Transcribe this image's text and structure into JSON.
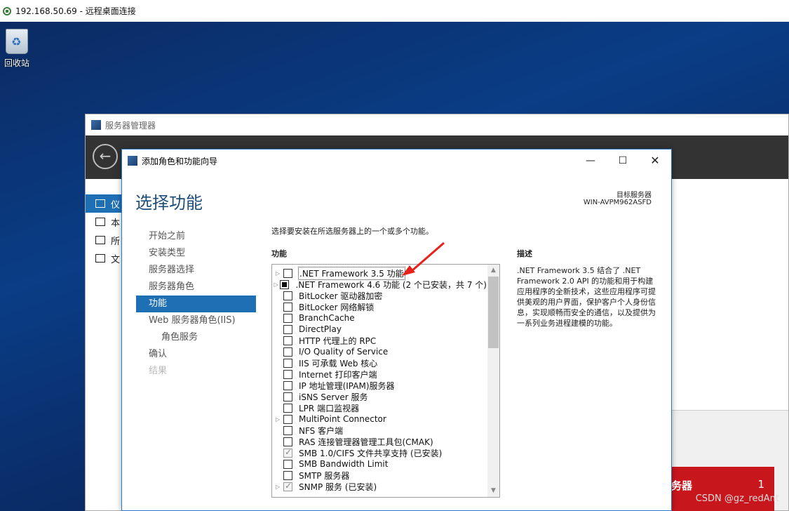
{
  "rdp": {
    "title": "192.168.50.69 - 远程桌面连接"
  },
  "desktop": {
    "recycle_bin_label": "回收站"
  },
  "server_manager": {
    "title": "服务器管理器",
    "back_icon": "back-arrow-icon",
    "nav_items": [
      "仪",
      "本",
      "所",
      "文"
    ],
    "tile_label": "务器",
    "tile_count": "1",
    "accent_color": "#1f6fb5",
    "tile_color": "#c8161d"
  },
  "wizard": {
    "title": "添加角色和功能向导",
    "heading": "选择功能",
    "target_label": "目标服务器",
    "target_value": "WIN-AVPM962ASFD",
    "steps": [
      {
        "label": "开始之前",
        "state": "normal"
      },
      {
        "label": "安装类型",
        "state": "normal"
      },
      {
        "label": "服务器选择",
        "state": "normal"
      },
      {
        "label": "服务器角色",
        "state": "normal"
      },
      {
        "label": "功能",
        "state": "active"
      },
      {
        "label": "Web 服务器角色(IIS)",
        "state": "normal"
      },
      {
        "label": "角色服务",
        "state": "sub"
      },
      {
        "label": "确认",
        "state": "normal"
      },
      {
        "label": "结果",
        "state": "disabled"
      }
    ],
    "intro": "选择要安装在所选服务器上的一个或多个功能。",
    "features_heading": "功能",
    "description_heading": "描述",
    "description": ".NET Framework 3.5 结合了 .NET Framework 2.0 API 的功能和用于构建应用程序的全新技术，这些应用程序可提供美观的用户界面，保护客户个人身份信息，实现顺畅而安全的通信，以及提供为一系列业务进程建模的功能。",
    "features": [
      {
        "label": ".NET Framework 3.5 功能",
        "expandable": true,
        "state": "unchecked",
        "selected": true
      },
      {
        "label": ".NET Framework 4.6 功能 (2 个已安装，共 7 个)",
        "expandable": true,
        "state": "partial",
        "selected": false
      },
      {
        "label": "BitLocker 驱动器加密",
        "expandable": false,
        "state": "unchecked",
        "selected": false
      },
      {
        "label": "BitLocker 网络解锁",
        "expandable": false,
        "state": "unchecked",
        "selected": false
      },
      {
        "label": "BranchCache",
        "expandable": false,
        "state": "unchecked",
        "selected": false
      },
      {
        "label": "DirectPlay",
        "expandable": false,
        "state": "unchecked",
        "selected": false
      },
      {
        "label": "HTTP 代理上的 RPC",
        "expandable": false,
        "state": "unchecked",
        "selected": false
      },
      {
        "label": "I/O Quality of Service",
        "expandable": false,
        "state": "unchecked",
        "selected": false
      },
      {
        "label": "IIS 可承载 Web 核心",
        "expandable": false,
        "state": "unchecked",
        "selected": false
      },
      {
        "label": "Internet 打印客户端",
        "expandable": false,
        "state": "unchecked",
        "selected": false
      },
      {
        "label": "IP 地址管理(IPAM)服务器",
        "expandable": false,
        "state": "unchecked",
        "selected": false
      },
      {
        "label": "iSNS Server 服务",
        "expandable": false,
        "state": "unchecked",
        "selected": false
      },
      {
        "label": "LPR 端口监视器",
        "expandable": false,
        "state": "unchecked",
        "selected": false
      },
      {
        "label": "MultiPoint Connector",
        "expandable": true,
        "state": "unchecked",
        "selected": false
      },
      {
        "label": "NFS 客户端",
        "expandable": false,
        "state": "unchecked",
        "selected": false
      },
      {
        "label": "RAS 连接管理器管理工具包(CMAK)",
        "expandable": false,
        "state": "unchecked",
        "selected": false
      },
      {
        "label": "SMB 1.0/CIFS 文件共享支持 (已安装)",
        "expandable": false,
        "state": "checked",
        "selected": false
      },
      {
        "label": "SMB Bandwidth Limit",
        "expandable": false,
        "state": "unchecked",
        "selected": false
      },
      {
        "label": "SMTP 服务器",
        "expandable": false,
        "state": "unchecked",
        "selected": false
      },
      {
        "label": "SNMP 服务 (已安装)",
        "expandable": true,
        "state": "checked",
        "selected": false
      }
    ],
    "window_buttons": {
      "minimize": "—",
      "maximize": "☐",
      "close": "✕"
    },
    "annotation_color": "#e8201c"
  },
  "watermark": "CSDN @gz_redAnt"
}
